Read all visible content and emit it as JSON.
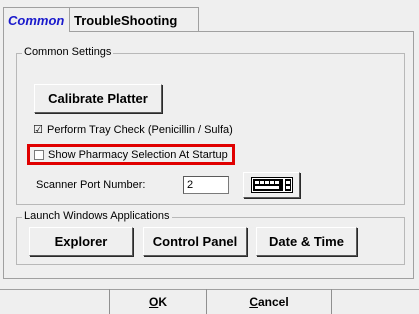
{
  "tabs": [
    {
      "label": "Common"
    },
    {
      "label": "TroubleShooting"
    }
  ],
  "common_settings": {
    "legend": "Common Settings",
    "calibrate_label": "Calibrate Platter",
    "tray_check_label": "Perform Tray Check (Penicillin / Sulfa)",
    "tray_check_checked": true,
    "pharmacy_label": "Show Pharmacy Selection At Startup",
    "pharmacy_checked": false,
    "scanner_label": "Scanner Port Number:",
    "scanner_value": "2",
    "keyboard_icon": "keyboard-icon"
  },
  "launch": {
    "legend": "Launch Windows Applications",
    "explorer_label": "Explorer",
    "control_panel_label": "Control Panel",
    "date_time_label": "Date & Time"
  },
  "footer": {
    "ok_mnemonic": "O",
    "ok_rest": "K",
    "cancel_mnemonic": "C",
    "cancel_rest": "ancel"
  },
  "colors": {
    "active_tab": "#1a1acc",
    "highlight": "#e00000",
    "background": "#efefef"
  }
}
